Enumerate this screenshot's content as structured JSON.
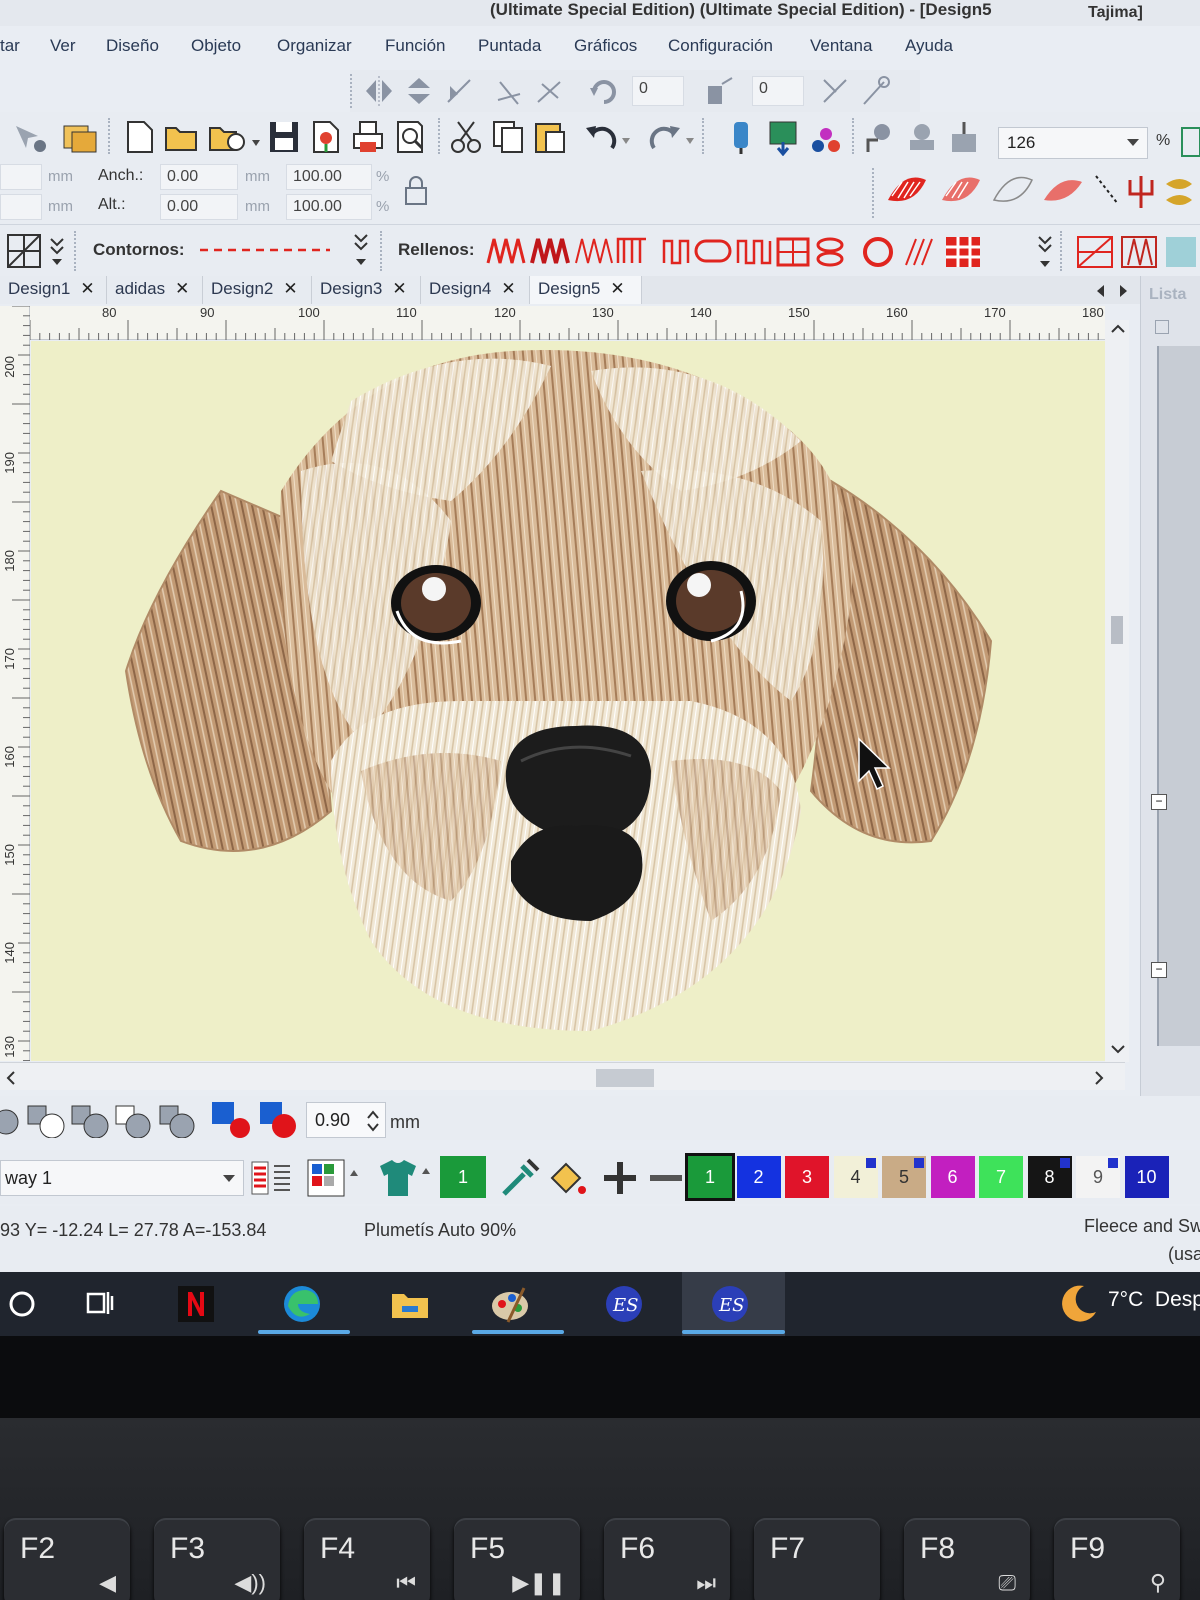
{
  "window": {
    "title": "(Ultimate Special Edition) (Ultimate Special Edition) - [Design5",
    "right_label": "Tajima]"
  },
  "menu": [
    "tar",
    "Ver",
    "Diseño",
    "Objeto",
    "Organizar",
    "Función",
    "Puntada",
    "Gráficos",
    "Configuración",
    "Ventana",
    "Ayuda"
  ],
  "toolbar1": {
    "rotate_value": "0",
    "skew_value": "0"
  },
  "toolbar2": {
    "zoom": "126",
    "zoom_unit": "%"
  },
  "size_panel": {
    "unit": "mm",
    "width_label": "Anch.:",
    "height_label": "Alt.:",
    "width_value": "0.00",
    "height_value": "0.00",
    "width_pct": "100.00",
    "height_pct": "100.00",
    "pct_unit": "%"
  },
  "stitch_bar": {
    "outlines_label": "Contornos:",
    "fills_label": "Rellenos:"
  },
  "tabs": [
    {
      "label": "Design1",
      "active": false
    },
    {
      "label": "adidas",
      "active": false
    },
    {
      "label": "Design2",
      "active": false
    },
    {
      "label": "Design3",
      "active": false
    },
    {
      "label": "Design4",
      "active": false
    },
    {
      "label": "Design5",
      "active": true
    }
  ],
  "side_panel_label": "Lista",
  "ruler": {
    "h_labels": [
      "80",
      "90",
      "100",
      "110",
      "120",
      "130",
      "140",
      "150",
      "160",
      "170",
      "180"
    ],
    "v_labels": [
      "200",
      "190",
      "180",
      "170",
      "160",
      "150",
      "140",
      "130"
    ]
  },
  "bottom_toolbar": {
    "width_value": "0.90",
    "unit": "mm"
  },
  "colorway": {
    "name": "way 1",
    "current_color": "1",
    "swatches": [
      {
        "label": "1",
        "color": "#1a9a3a",
        "text": "#ffffff"
      },
      {
        "label": "2",
        "color": "#1432e0",
        "text": "#ffffff"
      },
      {
        "label": "3",
        "color": "#e0142a",
        "text": "#ffffff"
      },
      {
        "label": "4",
        "color": "#f2f0d8",
        "text": "#333333"
      },
      {
        "label": "5",
        "color": "#c9ab86",
        "text": "#333333"
      },
      {
        "label": "6",
        "color": "#c21fc0",
        "text": "#ffffff"
      },
      {
        "label": "7",
        "color": "#3ee25a",
        "text": "#ffffff"
      },
      {
        "label": "8",
        "color": "#151515",
        "text": "#ffffff"
      },
      {
        "label": "9",
        "color": "#f3f3f3",
        "text": "#555555"
      },
      {
        "label": "10",
        "color": "#1a22b8",
        "text": "#ffffff"
      }
    ]
  },
  "status": {
    "coords": "93 Y= -12.24 L=  27.78 A=-153.84",
    "stitch_type": "Plumetís Auto 90%",
    "fabric": "Fleece and Sw",
    "fabric_sub": "(usa"
  },
  "taskbar": {
    "apps": [
      "search-circle",
      "task-view",
      "netflix",
      "edge",
      "file-explorer",
      "paint",
      "embird-es",
      "embird-es-active"
    ],
    "weather": "7°C",
    "weather_extra": "Desp"
  },
  "keyboard": {
    "keys": [
      {
        "label": "F2",
        "symbol": "◀"
      },
      {
        "label": "F3",
        "symbol": "◀))"
      },
      {
        "label": "F4",
        "symbol": "⏮"
      },
      {
        "label": "F5",
        "symbol": "▶❚❚"
      },
      {
        "label": "F6",
        "symbol": "⏭"
      },
      {
        "label": "F7",
        "symbol": ""
      },
      {
        "label": "F8",
        "symbol": "⎚"
      },
      {
        "label": "F9",
        "symbol": "⚲"
      }
    ]
  },
  "colors": {
    "canvas": "#eeefc8",
    "fur_brown": "#b98f6b",
    "fur_light": "#efe4d0",
    "nose": "#1c1c1c"
  }
}
